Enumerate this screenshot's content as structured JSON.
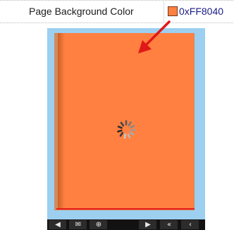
{
  "property": {
    "label": "Page Background Color",
    "value": "0xFF8040",
    "swatch_color": "#FF8040"
  },
  "preview": {
    "page_color": "#FF8040",
    "frame_color": "#9ccff0",
    "loading": true
  },
  "toolbar": {
    "buttons": [
      {
        "name": "sound-icon",
        "glyph": "◀"
      },
      {
        "name": "email-icon",
        "glyph": "✉"
      },
      {
        "name": "zoom-icon",
        "glyph": "⊕"
      },
      {
        "name": "play-icon",
        "glyph": "▶"
      },
      {
        "name": "first-page-icon",
        "glyph": "«"
      },
      {
        "name": "previous-page-icon",
        "glyph": "‹"
      }
    ]
  }
}
